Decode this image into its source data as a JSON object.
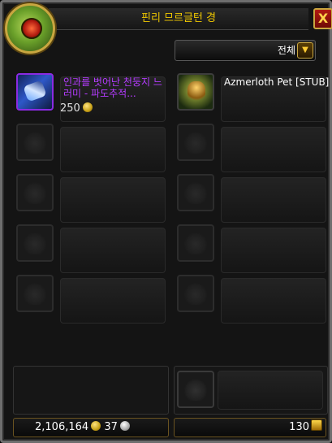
{
  "window": {
    "title": "핀리 므르글턴 경",
    "close_label": "X"
  },
  "filter": {
    "selected": "전체",
    "arrow_icon": "chevron-down-icon"
  },
  "items": [
    {
      "name": "인과를 벗어난 천둥지 느러미 - 파도추적...",
      "price": "250",
      "currency": "gold-coin-icon",
      "color": "#b43bff"
    },
    {
      "name": "Azmerloth Pet [STUB]",
      "price": "",
      "currency": "",
      "color": "#ffffff"
    }
  ],
  "money": {
    "gold": "2,106,164",
    "silver": "37"
  },
  "currency_right": {
    "amount": "130"
  }
}
